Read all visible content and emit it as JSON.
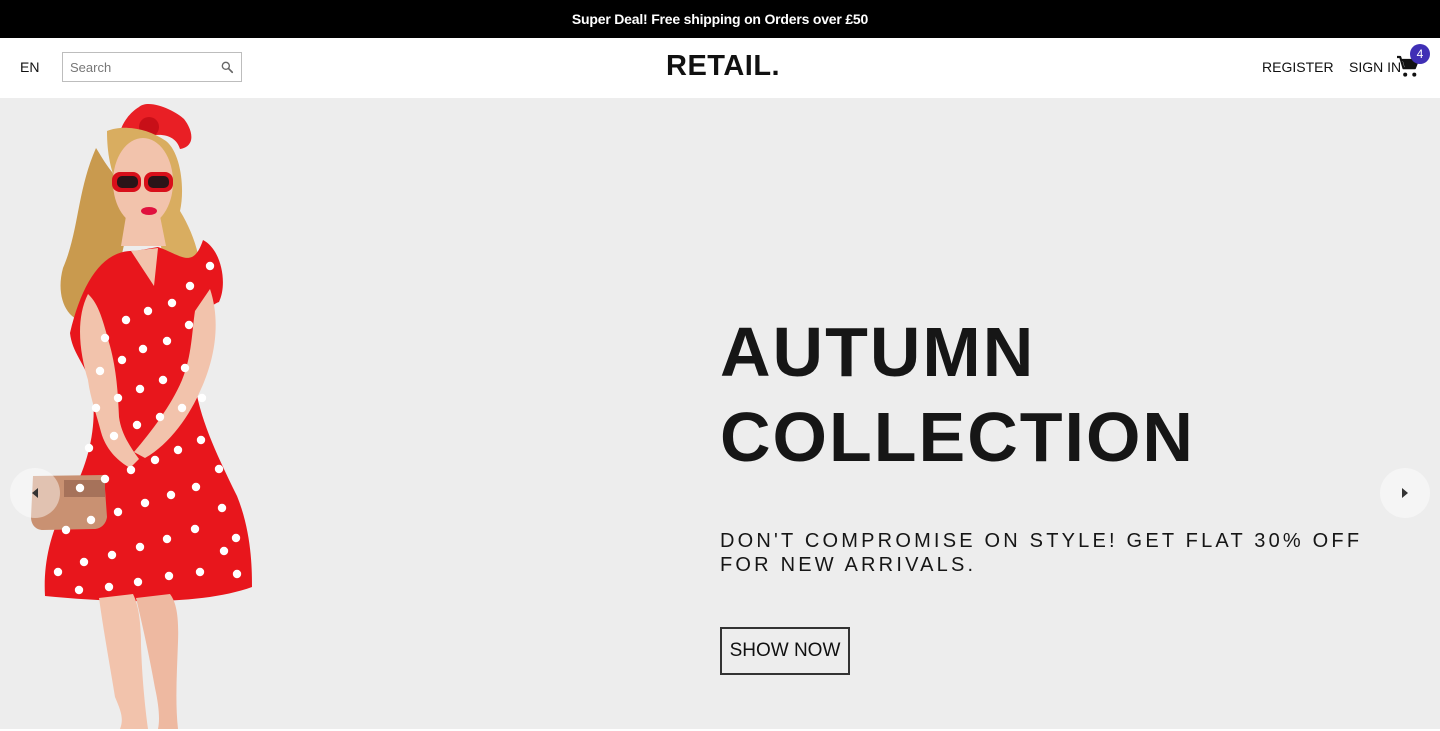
{
  "announcement": {
    "text": "Super Deal! Free shipping on Orders over £50"
  },
  "header": {
    "language": "EN",
    "search": {
      "placeholder": "Search",
      "value": ""
    },
    "logo": "RETAIL.",
    "register_label": "REGISTER",
    "signin_label": "SIGN IN",
    "cart_count": "4"
  },
  "hero": {
    "title_line1": "AUTUMN",
    "title_line2": "COLLECTION",
    "subtitle": "DON'T COMPROMISE ON STYLE! GET FLAT 30% OFF FOR NEW ARRIVALS.",
    "cta_label": "SHOW NOW",
    "background_color": "#ededed"
  },
  "icons": {
    "search": "search-icon",
    "cart": "shopping-cart-icon",
    "prev": "arrow-left-icon",
    "next": "arrow-right-icon"
  },
  "colors": {
    "announcement_bg": "#000000",
    "badge": "#3f2fb5",
    "dress": "#e8161c"
  }
}
